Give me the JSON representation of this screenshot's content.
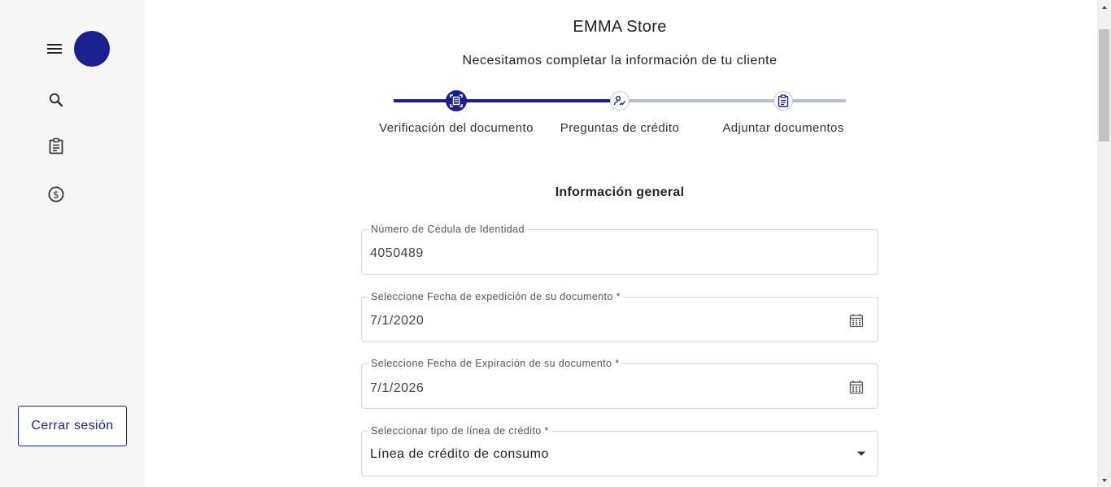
{
  "store": {
    "title": "EMMA Store",
    "subtitle": "Necesitamos completar la información de tu cliente"
  },
  "sidebar": {
    "menu_icon": "hamburger-menu-icon",
    "items": [
      {
        "icon": "search-icon"
      },
      {
        "icon": "clipboard-icon"
      },
      {
        "icon": "dollar-circle-icon"
      }
    ],
    "logout_label": "Cerrar sesión"
  },
  "stepper": {
    "steps": [
      {
        "label": "Verificación del documento",
        "icon": "document-scan-icon",
        "state": "active"
      },
      {
        "label": "Preguntas de crédito",
        "icon": "signature-icon",
        "state": "pending"
      },
      {
        "label": "Adjuntar documentos",
        "icon": "clipboard-list-icon",
        "state": "pending"
      }
    ]
  },
  "form": {
    "section_title": "Información general",
    "fields": [
      {
        "label": "Número de Cédula de Identidad",
        "value": "4050489"
      },
      {
        "label": "Seleccione Fecha de expedición de su documento *",
        "value": "7/1/2020",
        "icon": "calendar-icon"
      },
      {
        "label": "Seleccione Fecha de Expiración de su documento *",
        "value": "7/1/2026",
        "icon": "calendar-icon"
      },
      {
        "label": "Seleccionar tipo de línea de crédito *",
        "value": "Línea de crédito de consumo",
        "icon": "dropdown-arrow-icon"
      }
    ]
  },
  "colors": {
    "primary": "#1a1f8f",
    "inactive_line": "#b9bbd4",
    "sidebar_bg": "#f7f7f7"
  }
}
